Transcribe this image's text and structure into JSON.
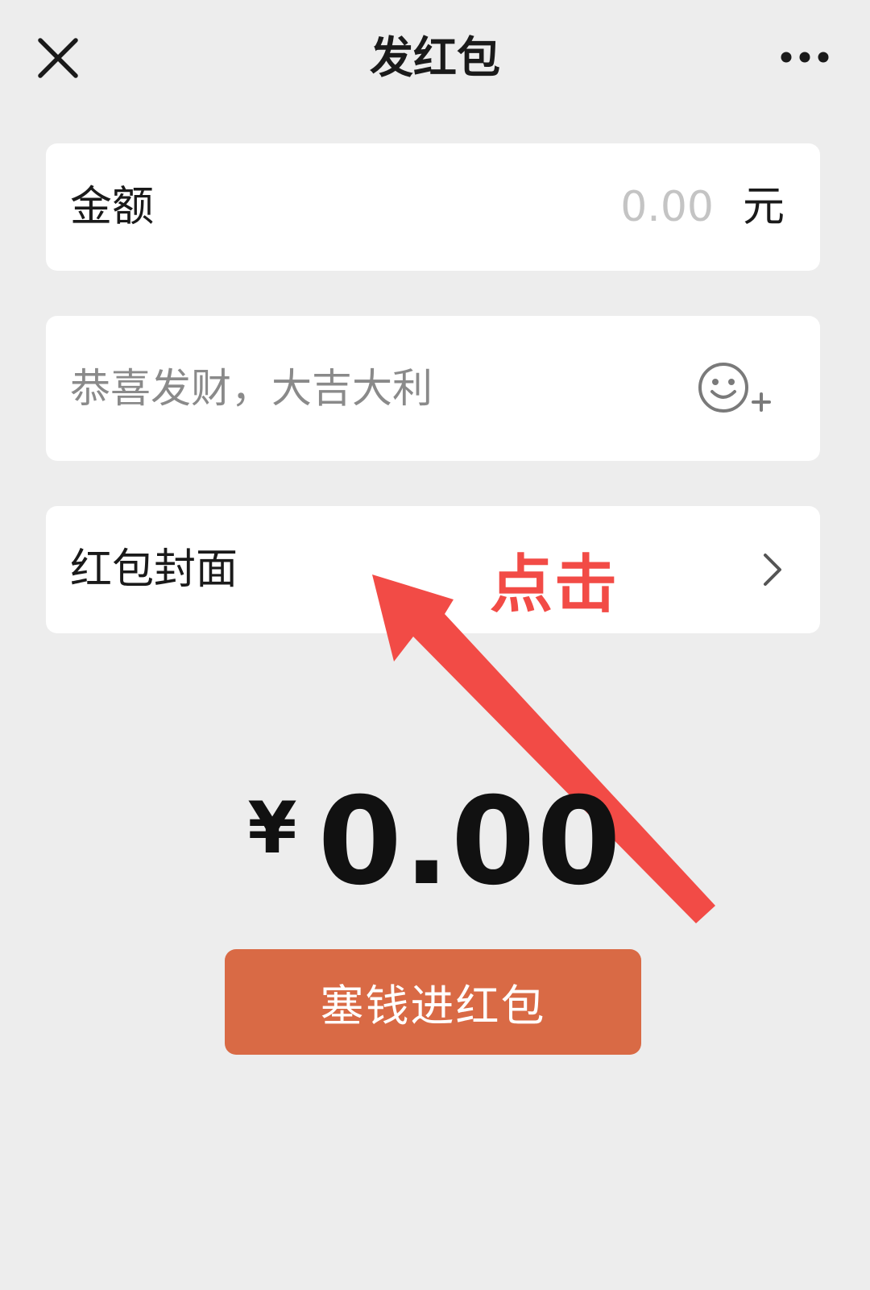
{
  "nav": {
    "close_icon": "close-icon",
    "title": "发红包",
    "more_icon": "more-icon"
  },
  "amount": {
    "label": "金额",
    "placeholder": "0.00",
    "unit": "元"
  },
  "message": {
    "placeholder": "恭喜发财，大吉大利",
    "emoji_icon": "emoji-add-icon"
  },
  "cover": {
    "label": "红包封面",
    "chevron_icon": "chevron-right-icon"
  },
  "annotation": {
    "text": "点击",
    "color": "#f24b46"
  },
  "total": {
    "currency": "¥",
    "value": "0.00"
  },
  "submit": {
    "label": "塞钱进红包",
    "color": "#d96a45"
  }
}
